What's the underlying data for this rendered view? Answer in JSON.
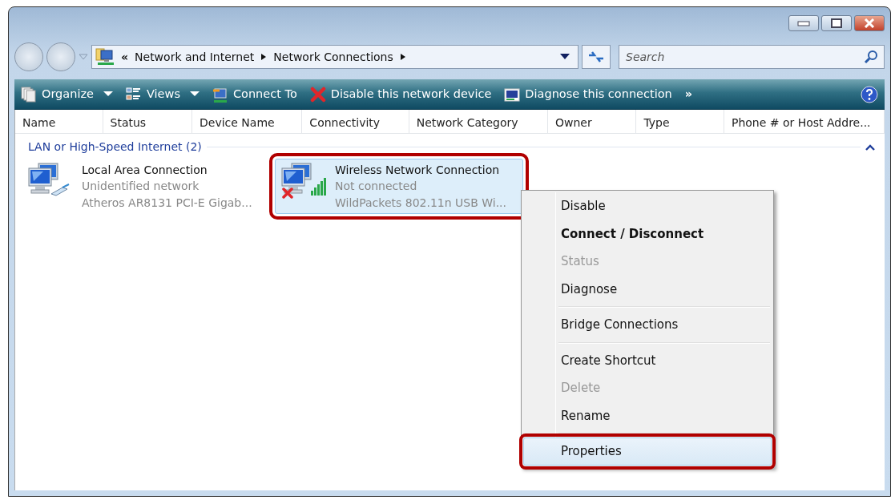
{
  "address_bar": {
    "overflow": "«",
    "crumbs": [
      "Network and Internet",
      "Network Connections"
    ]
  },
  "search": {
    "placeholder": "Search"
  },
  "toolbar": [
    {
      "label": "Organize",
      "dropdown": true,
      "kind": "organize"
    },
    {
      "label": "Views",
      "dropdown": true,
      "kind": "views"
    },
    {
      "label": "Connect To",
      "dropdown": false,
      "kind": "connect"
    },
    {
      "label": "Disable this network device",
      "dropdown": false,
      "kind": "disable"
    },
    {
      "label": "Diagnose this connection",
      "dropdown": false,
      "kind": "diagnose"
    }
  ],
  "toolbar_more": "»",
  "columns": [
    "Name",
    "Status",
    "Device Name",
    "Connectivity",
    "Network Category",
    "Owner",
    "Type",
    "Phone # or Host Addre..."
  ],
  "group": {
    "title": "LAN or High-Speed Internet (2)",
    "expanded": true
  },
  "connections": [
    {
      "name": "Local Area Connection",
      "status": "Unidentified network",
      "device": "Atheros AR8131 PCI-E Gigab...",
      "kind": "wired",
      "connected": true,
      "selected": false,
      "highlighted": false
    },
    {
      "name": "Wireless Network Connection",
      "status": "Not connected",
      "device": "WildPackets 802.11n USB Wi...",
      "kind": "wireless",
      "connected": false,
      "selected": true,
      "highlighted": true
    }
  ],
  "context_menu": [
    {
      "kind": "item",
      "label": "Disable",
      "default": false,
      "disabled": false,
      "highlighted": false
    },
    {
      "kind": "item",
      "label": "Connect / Disconnect",
      "default": true,
      "disabled": false,
      "highlighted": false
    },
    {
      "kind": "item",
      "label": "Status",
      "default": false,
      "disabled": true,
      "highlighted": false
    },
    {
      "kind": "item",
      "label": "Diagnose",
      "default": false,
      "disabled": false,
      "highlighted": false
    },
    {
      "kind": "separator"
    },
    {
      "kind": "item",
      "label": "Bridge Connections",
      "default": false,
      "disabled": false,
      "highlighted": false
    },
    {
      "kind": "separator"
    },
    {
      "kind": "item",
      "label": "Create Shortcut",
      "default": false,
      "disabled": false,
      "highlighted": false
    },
    {
      "kind": "item",
      "label": "Delete",
      "default": false,
      "disabled": true,
      "highlighted": false
    },
    {
      "kind": "item",
      "label": "Rename",
      "default": false,
      "disabled": false,
      "highlighted": false
    },
    {
      "kind": "separator"
    },
    {
      "kind": "item",
      "label": "Properties",
      "default": false,
      "disabled": false,
      "highlighted": true
    }
  ]
}
